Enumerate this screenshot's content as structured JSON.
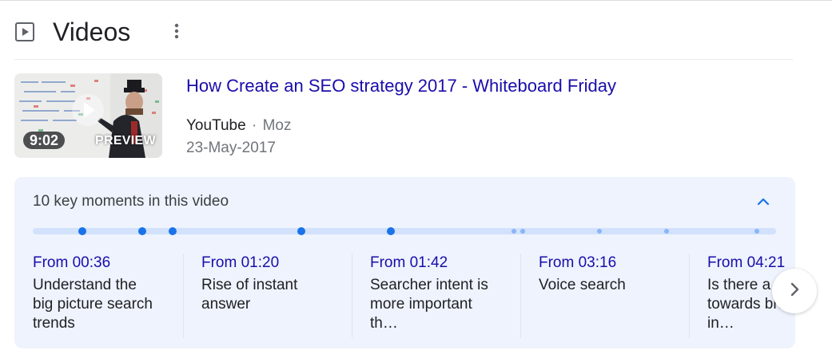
{
  "section": {
    "icon": "video-play-icon",
    "title": "Videos",
    "menu_icon": "more-vert-icon"
  },
  "video": {
    "duration": "9:02",
    "preview_label": "PREVIEW",
    "title": "How Create an SEO strategy 2017 - Whiteboard Friday",
    "source": "YouTube",
    "separator": "·",
    "channel": "Moz",
    "date": "23-May-2017"
  },
  "key_moments": {
    "title": "10 key moments in this video",
    "collapse_icon": "chevron-up-icon",
    "next_icon": "chevron-right-icon",
    "accent_color": "#1a73e8",
    "link_color": "#1a0dab",
    "panel_color": "#eef3fd",
    "timeline_total_seconds": 542,
    "markers": [
      {
        "seconds": 36,
        "major": true
      },
      {
        "seconds": 80,
        "major": true
      },
      {
        "seconds": 102,
        "major": true
      },
      {
        "seconds": 196,
        "major": true
      },
      {
        "seconds": 261,
        "major": true
      },
      {
        "seconds": 351,
        "major": false
      },
      {
        "seconds": 357,
        "major": false
      },
      {
        "seconds": 413,
        "major": false
      },
      {
        "seconds": 462,
        "major": false
      },
      {
        "seconds": 528,
        "major": false
      }
    ],
    "moments": [
      {
        "time": "From 00:36",
        "label": "Understand the big picture search trends"
      },
      {
        "time": "From 01:20",
        "label": "Rise of instant answer"
      },
      {
        "time": "From 01:42",
        "label": "Searcher intent is more important th…"
      },
      {
        "time": "From 03:16",
        "label": "Voice search"
      },
      {
        "time": "From 04:21",
        "label": "Is there a shift towards brands in…"
      }
    ]
  }
}
